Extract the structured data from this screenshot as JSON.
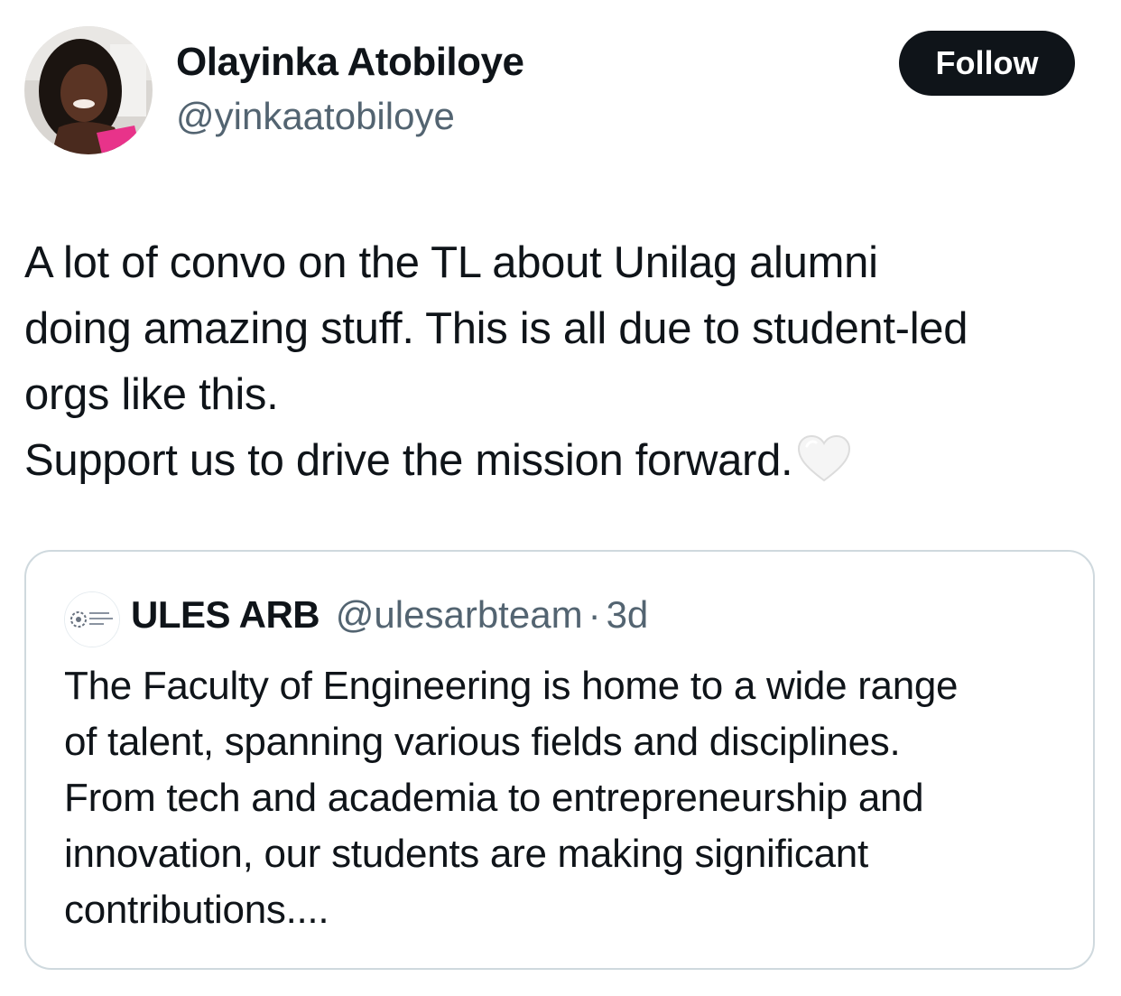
{
  "author": {
    "name": "Olayinka Atobiloye",
    "handle": "@yinkaatobiloye",
    "avatar_icon": "profile-photo"
  },
  "follow_button": {
    "label": "Follow",
    "background": "#0f1419",
    "text_color": "#ffffff"
  },
  "tweet": {
    "lines": [
      "A lot of convo on the TL about Unilag alumni",
      "doing amazing stuff. This is all due to student-led",
      "orgs like this.",
      "Support us to drive the mission forward."
    ],
    "emoji": "white-heart-icon"
  },
  "quoted_tweet": {
    "name": "ULES ARB",
    "handle": "@ulesarbteam",
    "separator": "·",
    "time": "3d",
    "avatar_icon": "org-logo",
    "lines": [
      "The Faculty of Engineering is home to a wide range",
      "of talent, spanning various fields and disciplines.",
      "From tech and academia to entrepreneurship and",
      "innovation, our students are making significant",
      "contributions...."
    ]
  },
  "colors": {
    "text_primary": "#0f1419",
    "text_secondary": "#536471",
    "border": "#cfd9de"
  }
}
